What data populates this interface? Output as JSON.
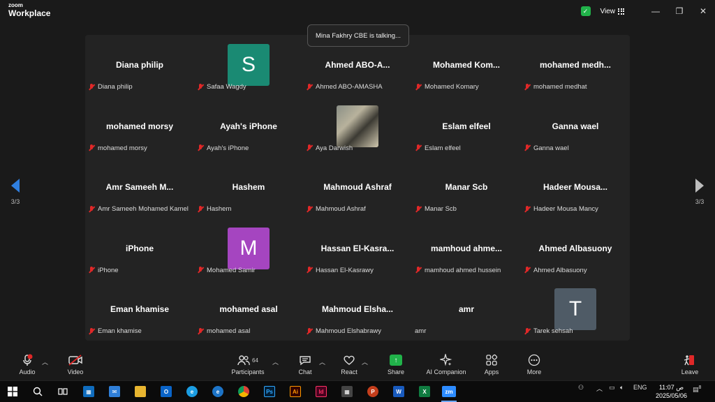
{
  "titlebar": {
    "brand_top": "zoom",
    "brand_bottom": "Workplace",
    "view_label": "View",
    "shield_color": "#21b34a"
  },
  "toast": {
    "text": "Mina Fakhry CBE is talking..."
  },
  "pagination": {
    "left": "3/3",
    "right": "3/3"
  },
  "tiles": [
    {
      "big": "Diana philip",
      "label": "Diana philip"
    },
    {
      "big": "",
      "label": "Safaa Wagdy",
      "avatar": "S",
      "avatar_color": "#1a8a73"
    },
    {
      "big": "Ahmed  ABO-A...",
      "label": "Ahmed ABO-AMASHA"
    },
    {
      "big": "Mohamed  Kom...",
      "label": "Mohamed Komary"
    },
    {
      "big": "mohamed  medh...",
      "label": "mohamed medhat"
    },
    {
      "big": "mohamed morsy",
      "label": "mohamed morsy"
    },
    {
      "big": "Ayah's iPhone",
      "label": "Ayah's iPhone"
    },
    {
      "big": "",
      "label": "Aya Darwish",
      "photo": true
    },
    {
      "big": "Eslam elfeel",
      "label": "Eslam elfeel"
    },
    {
      "big": "Ganna wael",
      "label": "Ganna wael"
    },
    {
      "big": "Amr  Sameeh  M...",
      "label": "Amr Sameeh Mohamed Kamel"
    },
    {
      "big": "Hashem",
      "label": "Hashem"
    },
    {
      "big": "Mahmoud Ashraf",
      "label": "Mahmoud Ashraf"
    },
    {
      "big": "Manar Scb",
      "label": "Manar Scb"
    },
    {
      "big": "Hadeer  Mousa...",
      "label": "Hadeer Mousa Mancy"
    },
    {
      "big": "iPhone",
      "label": "iPhone"
    },
    {
      "big": "",
      "label": "Mohamed Samir",
      "avatar": "M",
      "avatar_color": "#a545c0"
    },
    {
      "big": "Hassan  El-Kasra...",
      "label": "Hassan El-Kasrawy"
    },
    {
      "big": "mamhoud  ahme...",
      "label": "mamhoud ahmed hussein"
    },
    {
      "big": "Ahmed Albasuony",
      "label": "Ahmed Albasuony"
    },
    {
      "big": "Eman khamise",
      "label": "Eman khamise"
    },
    {
      "big": "mohamed asal",
      "label": "mohamed asal"
    },
    {
      "big": "Mahmoud  Elsha...",
      "label": "Mahmoud Elshabrawy"
    },
    {
      "big": "amr",
      "label": "amr",
      "mic_on": true
    },
    {
      "big": "",
      "label": "Tarek sehsah",
      "avatar": "T",
      "avatar_color": "#4f5b66"
    }
  ],
  "toolbar": {
    "audio": "Audio",
    "video": "Video",
    "participants": "Participants",
    "participants_count": "64",
    "chat": "Chat",
    "react": "React",
    "share": "Share",
    "ai": "AI Companion",
    "apps": "Apps",
    "more": "More",
    "leave": "Leave"
  },
  "taskbar": {
    "lang": "ENG",
    "time": "11:07 ص",
    "date": "2025/05/06",
    "notif_count": "8"
  }
}
